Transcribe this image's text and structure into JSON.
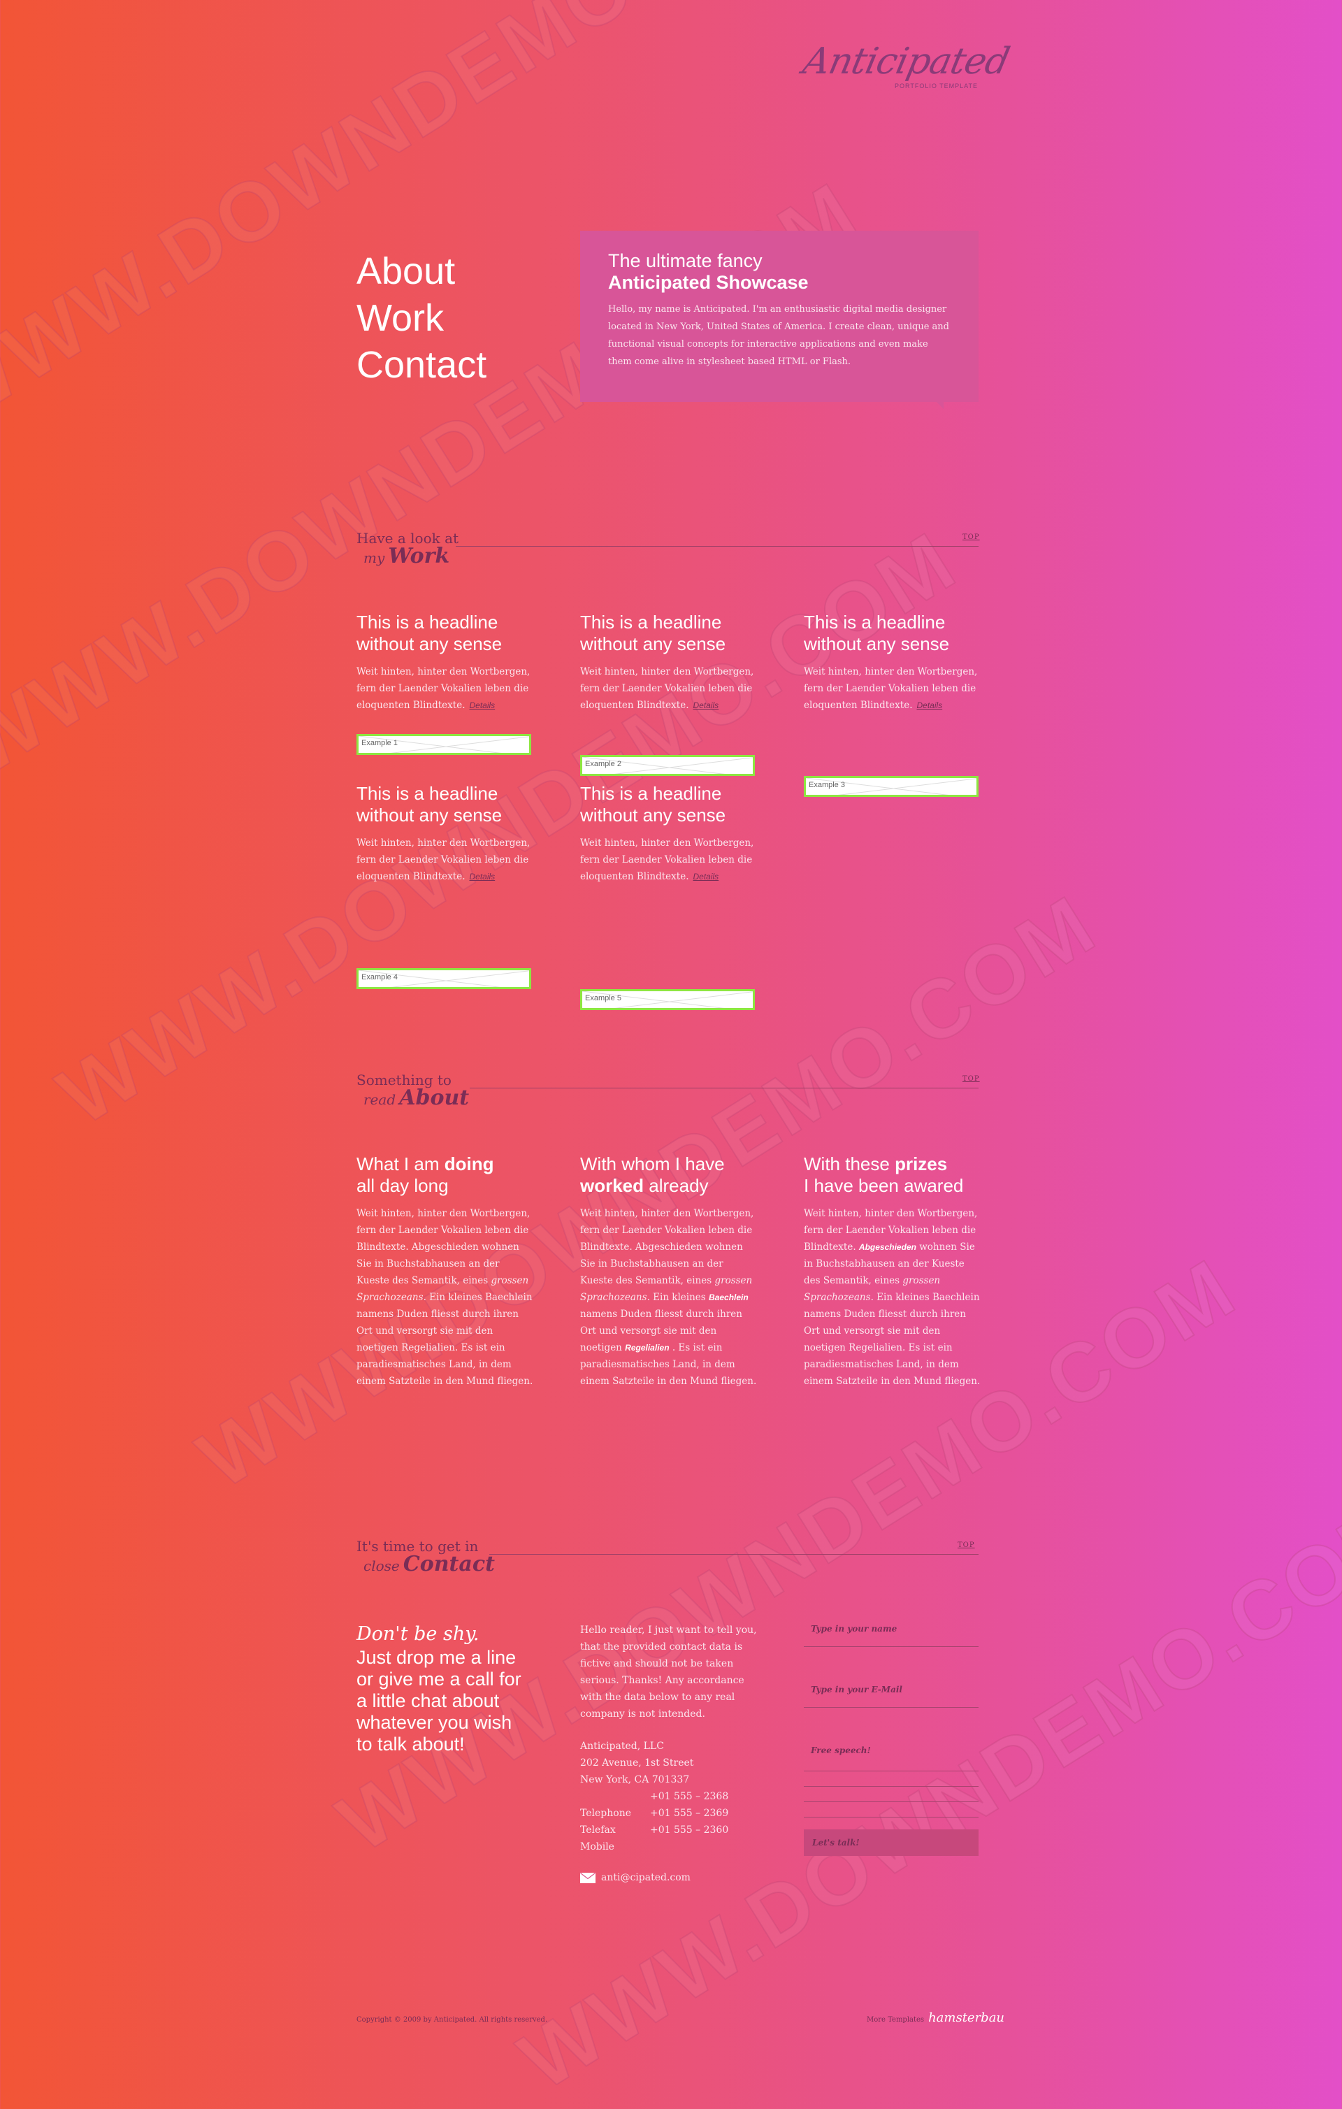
{
  "logo": {
    "name": "Anticipated",
    "tagline": "PORTFOLIO TEMPLATE"
  },
  "nav": {
    "items": [
      "About",
      "Work",
      "Contact"
    ]
  },
  "intro": {
    "title_line1": "The ultimate fancy",
    "title_line2": "Anticipated Showcase",
    "text": "Hello, my name is Anticipated. I'm an enthusiastic digital media designer located in New York, United States of America. I create clean, unique and functional visual concepts for interactive applications and even make them come alive in stylesheet based HTML or Flash."
  },
  "work": {
    "pre": "Have a look at",
    "sub": "my",
    "title": "Work",
    "top_link": "TOP",
    "items": [
      {
        "headline": "This is a headline without any sense",
        "text": "Weit hinten, hinter den Wortbergen, fern der Laender Vokalien leben die eloquenten Blindtexte.",
        "details": "Details",
        "image": "Example 1"
      },
      {
        "headline": "This is a headline without any sense",
        "text": "Weit hinten, hinter den Wortbergen, fern der Laender Vokalien leben die eloquenten Blindtexte.",
        "details": "Details",
        "image": "Example 2"
      },
      {
        "headline": "This is a headline without any sense",
        "text": "Weit hinten, hinter den Wortbergen, fern der Laender Vokalien leben die eloquenten Blindtexte.",
        "details": "Details",
        "image": "Example 3"
      },
      {
        "headline": "This is a headline without any sense",
        "text": "Weit hinten, hinter den Wortbergen, fern der Laender Vokalien leben die eloquenten Blindtexte.",
        "details": "Details",
        "image": "Example 4"
      },
      {
        "headline": "This is a headline without any sense",
        "text": "Weit hinten, hinter den Wortbergen, fern der Laender Vokalien leben die eloquenten Blindtexte.",
        "details": "Details",
        "image": "Example 5"
      }
    ]
  },
  "about": {
    "pre": "Something to",
    "sub": "read",
    "title": "About",
    "top_link": "TOP",
    "cols": [
      {
        "h_a": "What I am ",
        "h_b": "doing",
        "h_c": "all day long"
      },
      {
        "h_a": "With whom I have",
        "h_b": "worked",
        "h_c": " already"
      },
      {
        "h_a": "With these ",
        "h_b": "prizes",
        "h_c": "I have been awared"
      }
    ],
    "text_a": "Weit hinten, hinter den Wortbergen, fern der Laender Vokalien leben die Blindtexte. Abgeschieden wohnen Sie in Buchstabhausen an der Kueste des Semantik, eines ",
    "text_em": "grossen Sprachozeans",
    "text_b": ". Ein kleines Baechlein namens Duden fliesst durch ihren Ort und versorgt sie mit den noetigen Regelialien. Es ist ein paradiesmatisches Land, in dem einem Satzteile in den Mund fliegen.",
    "col2_a": "Weit hinten, hinter den Wortbergen, fern der Laender Vokalien leben die Blindtexte. Abgeschieden wohnen Sie in Buchstabhausen an der Kueste des Semantik, eines ",
    "col2_em": "grossen Sprachozeans",
    "col2_b": ". Ein kleines ",
    "col2_kw1": "Baechlein",
    "col2_c": " namens Duden fliesst durch ihren Ort und versorgt sie mit den noetigen ",
    "col2_kw2": "Regelialien",
    "col2_d": " . Es ist ein paradiesmatisches Land, in dem einem Satzteile in den Mund fliegen.",
    "col3_a": "Weit hinten, hinter den Wortbergen, fern der Laender Vokalien leben die Blindtexte. ",
    "col3_kw": "Abgeschieden",
    "col3_b": " wohnen Sie in Buchstabhausen an der Kueste des Semantik, eines ",
    "col3_em": "grossen Sprachozeans",
    "col3_c": ". Ein kleines Baechlein namens Duden fliesst durch ihren Ort und versorgt sie mit den noetigen Regelialien. Es ist ein paradiesmatisches Land, in dem einem Satzteile in den Mund fliegen."
  },
  "contact": {
    "pre": "It's time to get in",
    "sub": "close",
    "title": "Contact",
    "top_link": "TOP",
    "shy_line1": "Don't be shy.",
    "shy_line2": "Just drop me a line or give me a call for a little chat about whatever you wish to talk about!",
    "notice": "Hello reader, I just want to tell you, that the provided contact data is fictive and should not be taken serious. Thanks! Any accordance with the data below to any real company is not intended.",
    "company": "Anticipated, LLC",
    "street": "202 Avenue, 1st Street",
    "city": "New York, CA 701337",
    "phone_labels": [
      "Telephone",
      "Telefax",
      "Mobile"
    ],
    "phone_values": [
      "+01 555 – 2368",
      "+01 555 – 2369",
      "+01 555 – 2360"
    ],
    "email": "anti@cipated.com",
    "form": {
      "name_placeholder": "Type in your name",
      "email_placeholder": "Type in your E-Mail",
      "message_placeholder": "Free speech!",
      "submit_label": "Let's talk!"
    }
  },
  "footer": {
    "copyright": "Copyright © 2009 by Anticipated. All rights reserved.",
    "more": "More Templates",
    "brand": "hamsterbau"
  },
  "watermark": {
    "text": "WWW.DOWNDEMO.COM"
  },
  "colors": {
    "accent_dark": "#7a2d56",
    "thumb_border": "#8ee641",
    "intro_box": "#d85598"
  }
}
